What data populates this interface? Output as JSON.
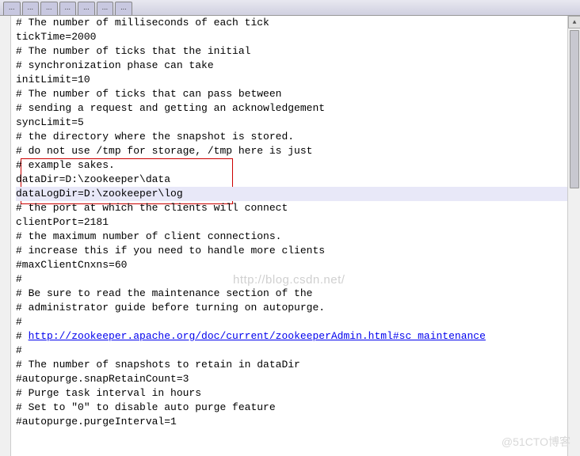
{
  "tabs": [
    {
      "label": "..."
    },
    {
      "label": "..."
    },
    {
      "label": "..."
    },
    {
      "label": "..."
    },
    {
      "label": "..."
    },
    {
      "label": "..."
    },
    {
      "label": "..."
    }
  ],
  "lines": [
    {
      "text": "# The number of milliseconds of each tick",
      "type": "comment"
    },
    {
      "text": "tickTime=2000",
      "type": "code"
    },
    {
      "text": "# The number of ticks that the initial",
      "type": "comment"
    },
    {
      "text": "# synchronization phase can take",
      "type": "comment"
    },
    {
      "text": "initLimit=10",
      "type": "code"
    },
    {
      "text": "# The number of ticks that can pass between",
      "type": "comment"
    },
    {
      "text": "# sending a request and getting an acknowledgement",
      "type": "comment"
    },
    {
      "text": "syncLimit=5",
      "type": "code"
    },
    {
      "text": "# the directory where the snapshot is stored.",
      "type": "comment"
    },
    {
      "text": "# do not use /tmp for storage, /tmp here is just",
      "type": "comment"
    },
    {
      "text": "# example sakes.",
      "type": "comment"
    },
    {
      "text": "dataDir=D:\\zookeeper\\data",
      "type": "code"
    },
    {
      "text": "dataLogDir=D:\\zookeeper\\log",
      "type": "code",
      "highlight": true
    },
    {
      "text": "# the port at which the clients will connect",
      "type": "comment"
    },
    {
      "text": "clientPort=2181",
      "type": "code"
    },
    {
      "text": "# the maximum number of client connections.",
      "type": "comment"
    },
    {
      "text": "# increase this if you need to handle more clients",
      "type": "comment"
    },
    {
      "text": "#maxClientCnxns=60",
      "type": "comment"
    },
    {
      "text": "#",
      "type": "comment"
    },
    {
      "text": "# Be sure to read the maintenance section of the",
      "type": "comment"
    },
    {
      "text": "# administrator guide before turning on autopurge.",
      "type": "comment"
    },
    {
      "text": "#",
      "type": "comment"
    },
    {
      "prefix": "# ",
      "text": "http://zookeeper.apache.org/doc/current/zookeeperAdmin.html#sc_maintenance",
      "type": "link"
    },
    {
      "text": "#",
      "type": "comment"
    },
    {
      "text": "# The number of snapshots to retain in dataDir",
      "type": "comment"
    },
    {
      "text": "#autopurge.snapRetainCount=3",
      "type": "comment"
    },
    {
      "text": "# Purge task interval in hours",
      "type": "comment"
    },
    {
      "text": "# Set to \"0\" to disable auto purge feature",
      "type": "comment"
    },
    {
      "text": "#autopurge.purgeInterval=1",
      "type": "comment"
    }
  ],
  "watermark1": "http://blog.csdn.net/",
  "watermark2": "@51CTO博客",
  "scroll": {
    "up": "▲",
    "down": "▼"
  }
}
